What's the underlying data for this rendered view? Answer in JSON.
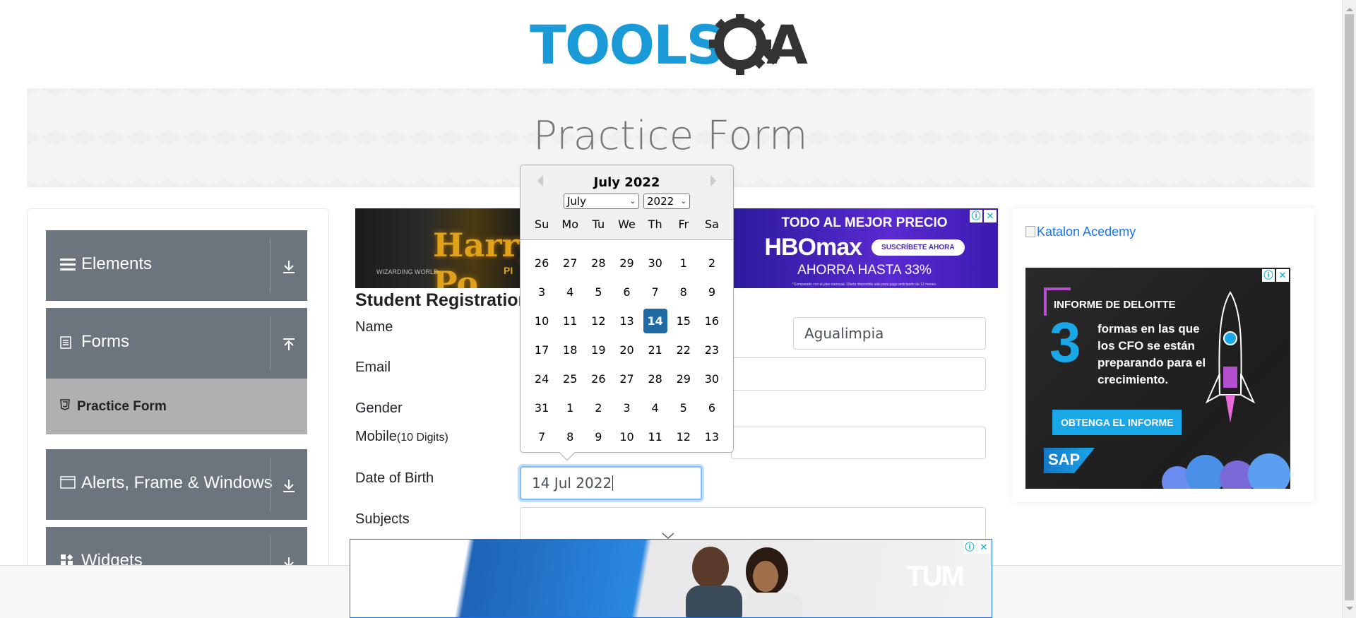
{
  "header": {
    "logo_text": "TOOLSQA"
  },
  "banner": {
    "title": "Practice Form"
  },
  "sidebar": {
    "groups": [
      {
        "label": "Elements",
        "icon": "hamburger-icon",
        "arrow": "download-arrow-icon"
      },
      {
        "label": "Forms",
        "icon": "document-icon",
        "arrow": "upload-arrow-icon"
      },
      {
        "label": "Alerts, Frame & Windows",
        "icon": "window-icon",
        "arrow": "download-arrow-icon"
      },
      {
        "label": "Widgets",
        "icon": "widgets-icon",
        "arrow": "download-arrow-icon"
      }
    ],
    "active_item": {
      "label": "Practice Form",
      "icon": "html5-icon"
    }
  },
  "form": {
    "title": "Student Registration",
    "labels": {
      "name": "Name",
      "email": "Email",
      "gender": "Gender",
      "mobile": "Mobile",
      "mobile_hint": "(10 Digits)",
      "dob": "Date of Birth",
      "subjects": "Subjects"
    },
    "last_name_value": "Agualimpia",
    "dob_value": "14 Jul 2022"
  },
  "datepicker": {
    "header": "July 2022",
    "month_select": "July",
    "year_select": "2022",
    "weekdays": [
      "Su",
      "Mo",
      "Tu",
      "We",
      "Th",
      "Fr",
      "Sa"
    ],
    "days": [
      "26",
      "27",
      "28",
      "29",
      "30",
      "1",
      "2",
      "3",
      "4",
      "5",
      "6",
      "7",
      "8",
      "9",
      "10",
      "11",
      "12",
      "13",
      "14",
      "15",
      "16",
      "17",
      "18",
      "19",
      "20",
      "21",
      "22",
      "23",
      "24",
      "25",
      "26",
      "27",
      "28",
      "29",
      "30",
      "31",
      "1",
      "2",
      "3",
      "4",
      "5",
      "6",
      "7",
      "8",
      "9",
      "10",
      "11",
      "12",
      "13"
    ],
    "selected_day": "14",
    "selected_color": "#216ba5"
  },
  "ads": {
    "top_left": {
      "text": "Harry Po",
      "sub": "WIZARDING WORLD",
      "tail": "PI"
    },
    "top_right": {
      "line1": "TODO AL MEJOR PRECIO",
      "brand": "HBOmax",
      "cta": "SUSCRÍBETE AHORA",
      "line3": "AHORRA HASTA 33%",
      "fine_print": "*Comparado con el plan mensual. Oferta disponible sólo para pago anticipado de 12 meses."
    },
    "right": {
      "katalon_alt": "Katalon Acedemy",
      "heading": "INFORME DE DELOITTE",
      "number": "3",
      "body": "formas en las que los CFO se están preparando para el crecimiento.",
      "button": "OBTENGA EL INFORME",
      "sap": "SAP"
    },
    "bottom": {
      "brand": "TUM"
    },
    "info_glyph": "ⓘ",
    "close_glyph": "✕"
  }
}
